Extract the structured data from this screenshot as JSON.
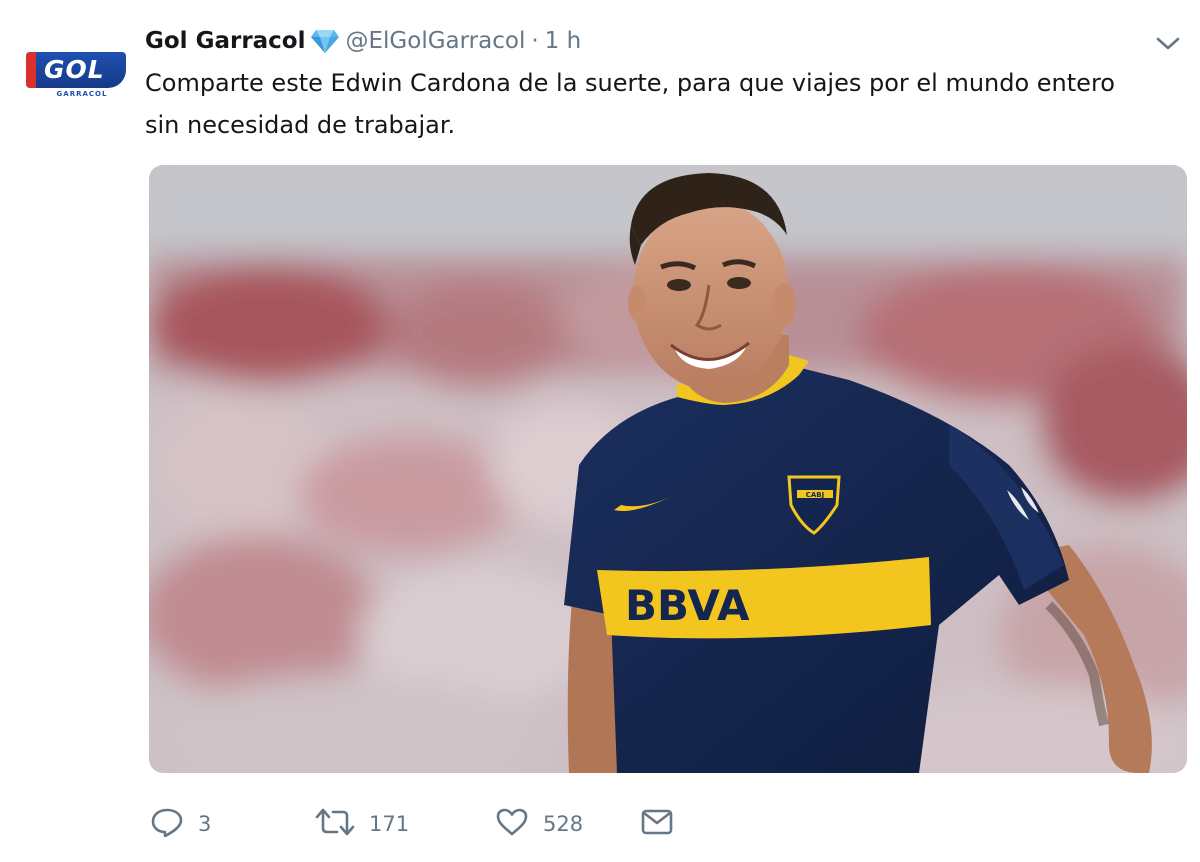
{
  "author": {
    "display_name": "Gol Garracol",
    "handle": "@ElGolGarracol",
    "separator": "·",
    "time": "1 h",
    "verified_icon": "diamond-icon",
    "avatar_text": "GOL",
    "avatar_subtext": "GARRACOL"
  },
  "tweet": {
    "text_line1": "Comparte este Edwin Cardona de la suerte, para que viajes por el mundo entero",
    "text_line2": "sin necesidad de trabajar."
  },
  "media": {
    "jersey_sponsor": "BBVA",
    "crest_text": "CABJ"
  },
  "actions": {
    "reply_count": "3",
    "retweet_count": "171",
    "like_count": "528"
  },
  "colors": {
    "text": "#14171a",
    "secondary": "#657786",
    "jersey_navy": "#14254f",
    "jersey_yellow": "#f3c61f",
    "logo_blue": "#1f4fb0",
    "logo_red": "#d9322e"
  }
}
